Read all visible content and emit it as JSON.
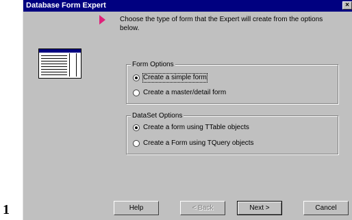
{
  "window": {
    "title": "Database Form Expert",
    "close_glyph": "×"
  },
  "instruction": "Choose the type of form that the Expert will create from the options below.",
  "form_options": {
    "legend": "Form Options",
    "options": [
      {
        "label": "Create a simple form",
        "checked": true
      },
      {
        "label": "Create a master/detail form",
        "checked": false
      }
    ]
  },
  "dataset_options": {
    "legend": "DataSet Options",
    "options": [
      {
        "label": "Create a form using TTable objects",
        "checked": true
      },
      {
        "label": "Create a Form using TQuery objects",
        "checked": false
      }
    ]
  },
  "buttons": {
    "help": "Help",
    "back": "< Back",
    "next": "Next >",
    "cancel": "Cancel"
  },
  "page_marker": "1",
  "colors": {
    "titlebar": "#000080",
    "arrow": "#e0207a",
    "face": "#c0c0c0"
  },
  "icons": {
    "arrow": "pink-pointer-arrow",
    "thumbnail": "form-preview-thumbnail"
  }
}
